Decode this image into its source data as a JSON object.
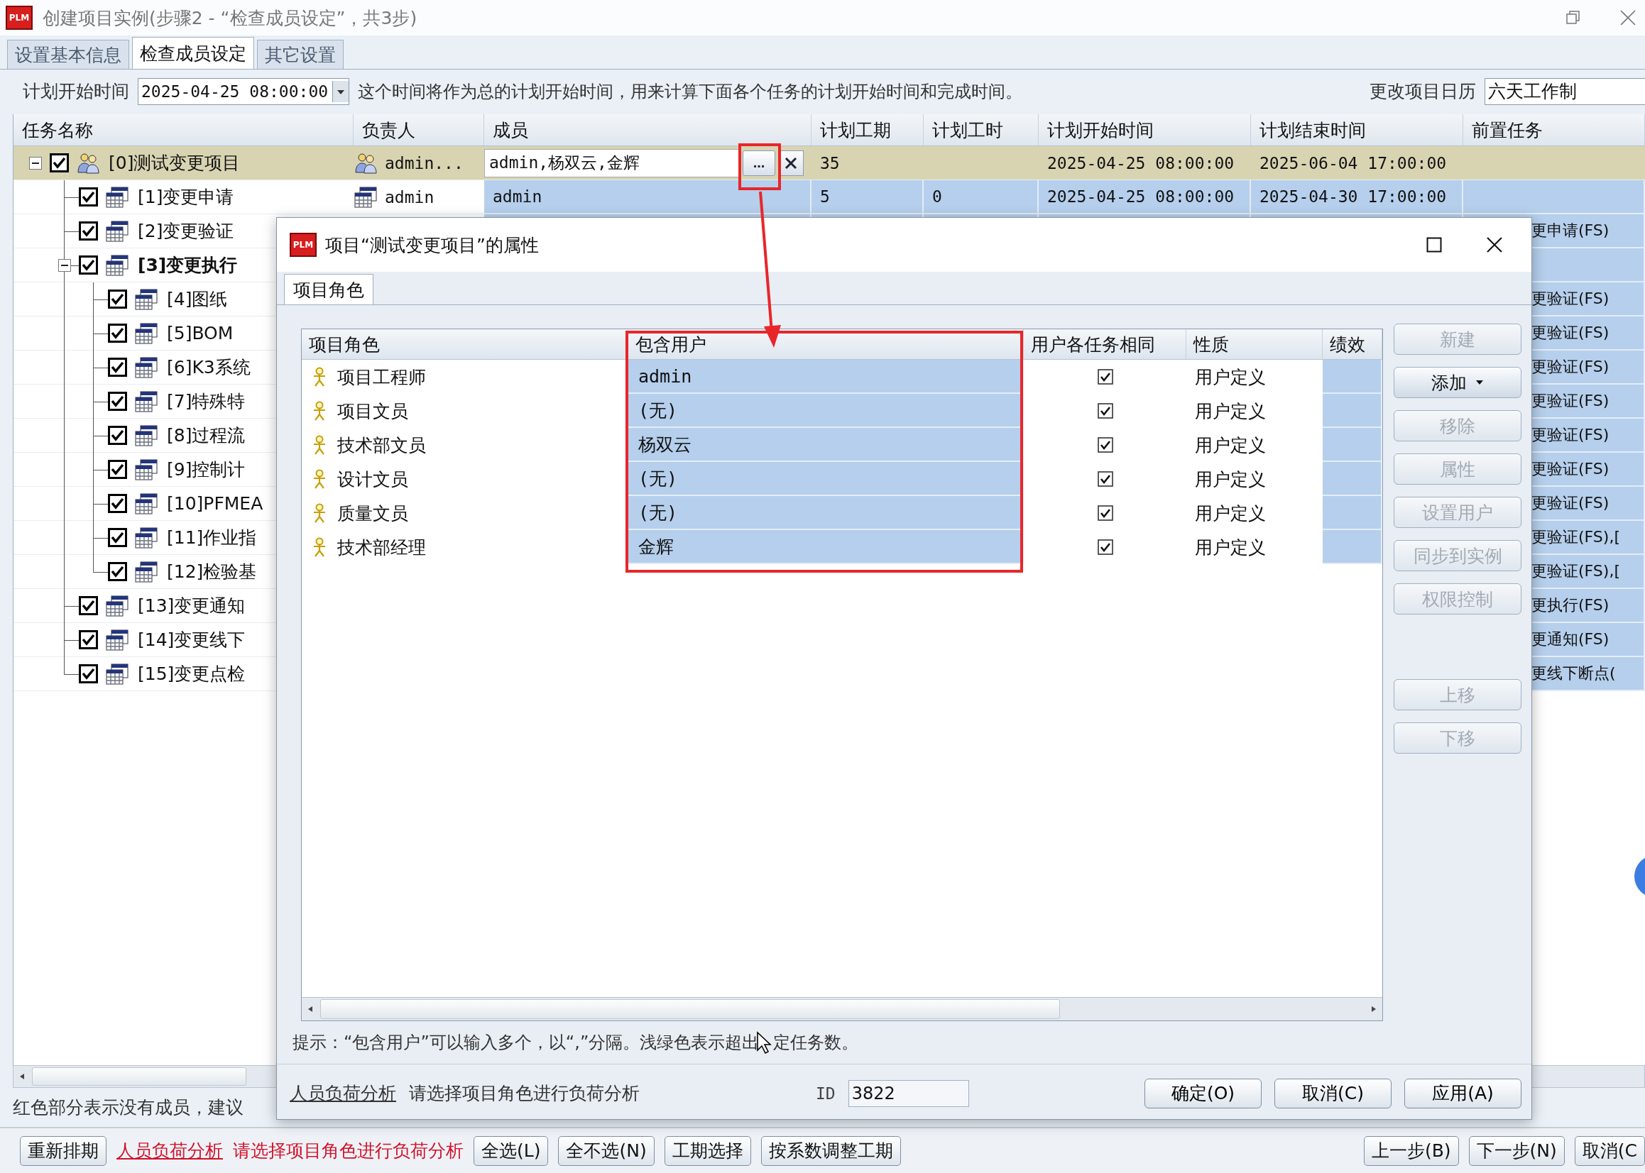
{
  "window": {
    "logo": "PLM",
    "title": "创建项目实例(步骤2 - “检查成员设定”，共3步)"
  },
  "tabs": [
    {
      "label": "设置基本信息",
      "selected": false
    },
    {
      "label": "检查成员设定",
      "selected": true
    },
    {
      "label": "其它设置",
      "selected": false
    }
  ],
  "schedule": {
    "label": "计划开始时间",
    "value": "2025-04-25 08:00:00",
    "hint": "这个时间将作为总的计划开始时间，用来计算下面各个任务的计划开始时间和完成时间。",
    "calendar_label": "更改项目日历",
    "calendar_value": "六天工作制"
  },
  "task_table": {
    "columns": [
      "任务名称",
      "负责人",
      "成员",
      "计划工期",
      "计划工时",
      "计划开始时间",
      "计划结束时间",
      "前置任务"
    ],
    "browse_label": "...",
    "rows": [
      {
        "name": "[0]测试变更项目",
        "kind": "project",
        "checked": true,
        "expanded": true,
        "bold": false,
        "selected": true,
        "owner": "admin...",
        "member": "admin,杨双云,金辉",
        "duration": "35",
        "start": "2025-04-25 08:00:00",
        "end": "2025-06-04 17:00:00",
        "children": [
          {
            "name": "[1]变更申请",
            "kind": "task",
            "checked": true,
            "bold": false,
            "selected": false,
            "owner": "admin",
            "member": "admin",
            "duration": "5",
            "hours": "0",
            "start": "2025-04-25 08:00:00",
            "end": "2025-04-30 17:00:00"
          },
          {
            "name": "[2]变更验证",
            "kind": "task",
            "checked": true,
            "bold": false,
            "selected": false,
            "predecessor": "更申请(FS)"
          },
          {
            "name": "[3]变更执行",
            "kind": "task",
            "checked": true,
            "expanded": true,
            "bold": true,
            "selected": false,
            "children": [
              {
                "name": "[4]图纸",
                "kind": "task",
                "checked": true,
                "bold": false,
                "selected": false,
                "predecessor": "更验证(FS)"
              },
              {
                "name": "[5]BOM",
                "kind": "task",
                "checked": true,
                "bold": false,
                "selected": false,
                "predecessor": "更验证(FS)"
              },
              {
                "name": "[6]K3系统",
                "kind": "task",
                "checked": true,
                "bold": false,
                "selected": false,
                "predecessor": "更验证(FS)"
              },
              {
                "name": "[7]特殊特",
                "kind": "task",
                "checked": true,
                "bold": false,
                "selected": false,
                "predecessor": "更验证(FS)"
              },
              {
                "name": "[8]过程流",
                "kind": "task",
                "checked": true,
                "bold": false,
                "selected": false,
                "predecessor": "更验证(FS)"
              },
              {
                "name": "[9]控制计",
                "kind": "task",
                "checked": true,
                "bold": false,
                "selected": false,
                "predecessor": "更验证(FS)"
              },
              {
                "name": "[10]PFMEA",
                "kind": "task",
                "checked": true,
                "bold": false,
                "selected": false,
                "predecessor": "更验证(FS)"
              },
              {
                "name": "[11]作业指",
                "kind": "task",
                "checked": true,
                "bold": false,
                "selected": false,
                "predecessor": "更验证(FS),["
              },
              {
                "name": "[12]检验基",
                "kind": "task",
                "checked": true,
                "bold": false,
                "selected": false,
                "predecessor": "更验证(FS),["
              }
            ]
          },
          {
            "name": "[13]变更通知",
            "kind": "task",
            "checked": true,
            "bold": false,
            "selected": false,
            "predecessor": "更执行(FS)"
          },
          {
            "name": "[14]变更线下",
            "kind": "task",
            "checked": true,
            "bold": false,
            "selected": false,
            "predecessor": "更通知(FS)"
          },
          {
            "name": "[15]变更点检",
            "kind": "task",
            "checked": true,
            "bold": false,
            "selected": false,
            "predecessor": "更线下断点("
          }
        ]
      }
    ]
  },
  "member_hint": "红色部分表示没有成员，建议",
  "footer": {
    "left": [
      {
        "label": "重新排期",
        "kind": "button"
      },
      {
        "label": "人员负荷分析",
        "kind": "link"
      },
      {
        "label": "请选择项目角色进行负荷分析",
        "kind": "warning"
      },
      {
        "label": "全选(L)",
        "kind": "button"
      },
      {
        "label": "全不选(N)",
        "kind": "button"
      },
      {
        "label": "工期选择",
        "kind": "button"
      },
      {
        "label": "按系数调整工期",
        "kind": "button"
      }
    ],
    "right": [
      {
        "label": "上一步(B)",
        "kind": "button"
      },
      {
        "label": "下一步(N)",
        "kind": "button"
      },
      {
        "label": "取消(C",
        "kind": "button"
      }
    ]
  },
  "dialog": {
    "logo": "PLM",
    "title": "项目“测试变更项目”的属性",
    "tabs": [
      {
        "label": "项目角色",
        "selected": true
      }
    ],
    "columns": [
      "项目角色",
      "包含用户",
      "用户各任务相同",
      "性质",
      "绩效"
    ],
    "roles": [
      {
        "name": "项目工程师",
        "users": "admin",
        "same_for_tasks": true,
        "nature": "用户定义"
      },
      {
        "name": "项目文员",
        "users": "(无)",
        "same_for_tasks": true,
        "nature": "用户定义"
      },
      {
        "name": "技术部文员",
        "users": "杨双云",
        "same_for_tasks": true,
        "nature": "用户定义"
      },
      {
        "name": "设计文员",
        "users": "(无)",
        "same_for_tasks": true,
        "nature": "用户定义"
      },
      {
        "name": "质量文员",
        "users": "(无)",
        "same_for_tasks": true,
        "nature": "用户定义"
      },
      {
        "name": "技术部经理",
        "users": "金辉",
        "same_for_tasks": true,
        "nature": "用户定义"
      }
    ],
    "actions": [
      {
        "label": "新建",
        "kind": "button",
        "disabled": true
      },
      {
        "label": "添加",
        "kind": "menu",
        "disabled": false
      },
      {
        "label": "移除",
        "kind": "button",
        "disabled": true
      },
      {
        "label": "属性",
        "kind": "button",
        "disabled": true
      },
      {
        "label": "设置用户",
        "kind": "button",
        "disabled": true
      },
      {
        "label": "同步到实例",
        "kind": "button",
        "disabled": true
      },
      {
        "label": "权限控制",
        "kind": "button",
        "disabled": true
      }
    ],
    "move_actions": [
      {
        "label": "上移",
        "disabled": true
      },
      {
        "label": "下移",
        "disabled": true
      }
    ],
    "hint_before_cursor": "提示：“包含用户”可以输入多个，以“,”分隔。浅绿色表示超出",
    "hint_after_cursor": "定任务数。",
    "load_link": "人员负荷分析",
    "load_text": "请选择项目角色进行负荷分析",
    "id_label": "ID",
    "id_value": "3822",
    "buttons": [
      "确定(O)",
      "取消(C)",
      "应用(A)"
    ]
  }
}
